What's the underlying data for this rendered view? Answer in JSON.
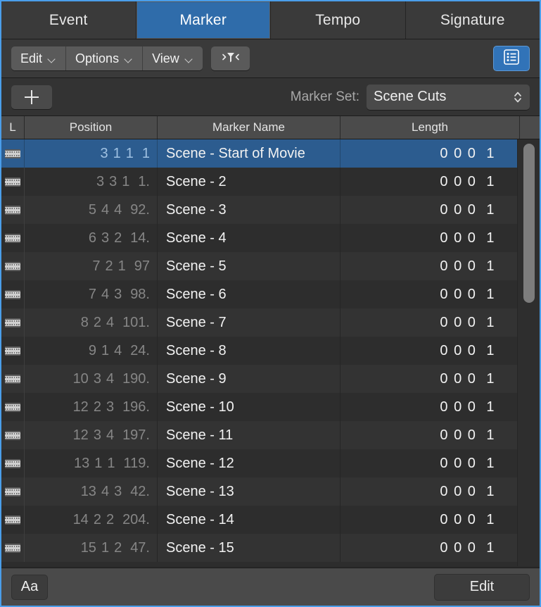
{
  "tabs": [
    {
      "label": "Event",
      "active": false
    },
    {
      "label": "Marker",
      "active": true
    },
    {
      "label": "Tempo",
      "active": false
    },
    {
      "label": "Signature",
      "active": false
    }
  ],
  "toolbar": {
    "menus": [
      "Edit",
      "Options",
      "View"
    ],
    "filter_icon": "funnel-filter-icon",
    "list_view_icon": "list-view-icon",
    "accent_color": "#3173b8"
  },
  "marker_set": {
    "add_icon": "plus-icon",
    "label": "Marker Set:",
    "value": "Scene Cuts",
    "stepper_icon": "up-down-chevron-icon"
  },
  "columns": [
    {
      "key": "l",
      "label": "L"
    },
    {
      "key": "pos",
      "label": "Position"
    },
    {
      "key": "name",
      "label": "Marker Name"
    },
    {
      "key": "length",
      "label": "Length"
    }
  ],
  "rows": [
    {
      "icon": "film-strip-icon",
      "bar": "3",
      "beat": "1",
      "div": "1",
      "tick": "1",
      "name": "Scene - Start of Movie",
      "length": "0 0 0",
      "length_tick": "1",
      "selected": true
    },
    {
      "icon": "film-strip-icon",
      "bar": "3",
      "beat": "3",
      "div": "1",
      "tick": "1.",
      "name": "Scene - 2",
      "length": "0 0 0",
      "length_tick": "1",
      "selected": false
    },
    {
      "icon": "film-strip-icon",
      "bar": "5",
      "beat": "4",
      "div": "4",
      "tick": "92.",
      "name": "Scene - 3",
      "length": "0 0 0",
      "length_tick": "1",
      "selected": false
    },
    {
      "icon": "film-strip-icon",
      "bar": "6",
      "beat": "3",
      "div": "2",
      "tick": "14.",
      "name": "Scene - 4",
      "length": "0 0 0",
      "length_tick": "1",
      "selected": false
    },
    {
      "icon": "film-strip-icon",
      "bar": "7",
      "beat": "2",
      "div": "1",
      "tick": "97",
      "name": "Scene - 5",
      "length": "0 0 0",
      "length_tick": "1",
      "selected": false
    },
    {
      "icon": "film-strip-icon",
      "bar": "7",
      "beat": "4",
      "div": "3",
      "tick": "98.",
      "name": "Scene - 6",
      "length": "0 0 0",
      "length_tick": "1",
      "selected": false
    },
    {
      "icon": "film-strip-icon",
      "bar": "8",
      "beat": "2",
      "div": "4",
      "tick": "101.",
      "name": "Scene - 7",
      "length": "0 0 0",
      "length_tick": "1",
      "selected": false
    },
    {
      "icon": "film-strip-icon",
      "bar": "9",
      "beat": "1",
      "div": "4",
      "tick": "24.",
      "name": "Scene - 8",
      "length": "0 0 0",
      "length_tick": "1",
      "selected": false
    },
    {
      "icon": "film-strip-icon",
      "bar": "10",
      "beat": "3",
      "div": "4",
      "tick": "190.",
      "name": "Scene - 9",
      "length": "0 0 0",
      "length_tick": "1",
      "selected": false
    },
    {
      "icon": "film-strip-icon",
      "bar": "12",
      "beat": "2",
      "div": "3",
      "tick": "196.",
      "name": "Scene - 10",
      "length": "0 0 0",
      "length_tick": "1",
      "selected": false
    },
    {
      "icon": "film-strip-icon",
      "bar": "12",
      "beat": "3",
      "div": "4",
      "tick": "197.",
      "name": "Scene - 11",
      "length": "0 0 0",
      "length_tick": "1",
      "selected": false
    },
    {
      "icon": "film-strip-icon",
      "bar": "13",
      "beat": "1",
      "div": "1",
      "tick": "119.",
      "name": "Scene - 12",
      "length": "0 0 0",
      "length_tick": "1",
      "selected": false
    },
    {
      "icon": "film-strip-icon",
      "bar": "13",
      "beat": "4",
      "div": "3",
      "tick": "42.",
      "name": "Scene - 13",
      "length": "0 0 0",
      "length_tick": "1",
      "selected": false
    },
    {
      "icon": "film-strip-icon",
      "bar": "14",
      "beat": "2",
      "div": "2",
      "tick": "204.",
      "name": "Scene - 14",
      "length": "0 0 0",
      "length_tick": "1",
      "selected": false
    },
    {
      "icon": "film-strip-icon",
      "bar": "15",
      "beat": "1",
      "div": "2",
      "tick": "47.",
      "name": "Scene - 15",
      "length": "0 0 0",
      "length_tick": "1",
      "selected": false
    }
  ],
  "bottom": {
    "text_button": "Aa",
    "edit_button": "Edit"
  }
}
